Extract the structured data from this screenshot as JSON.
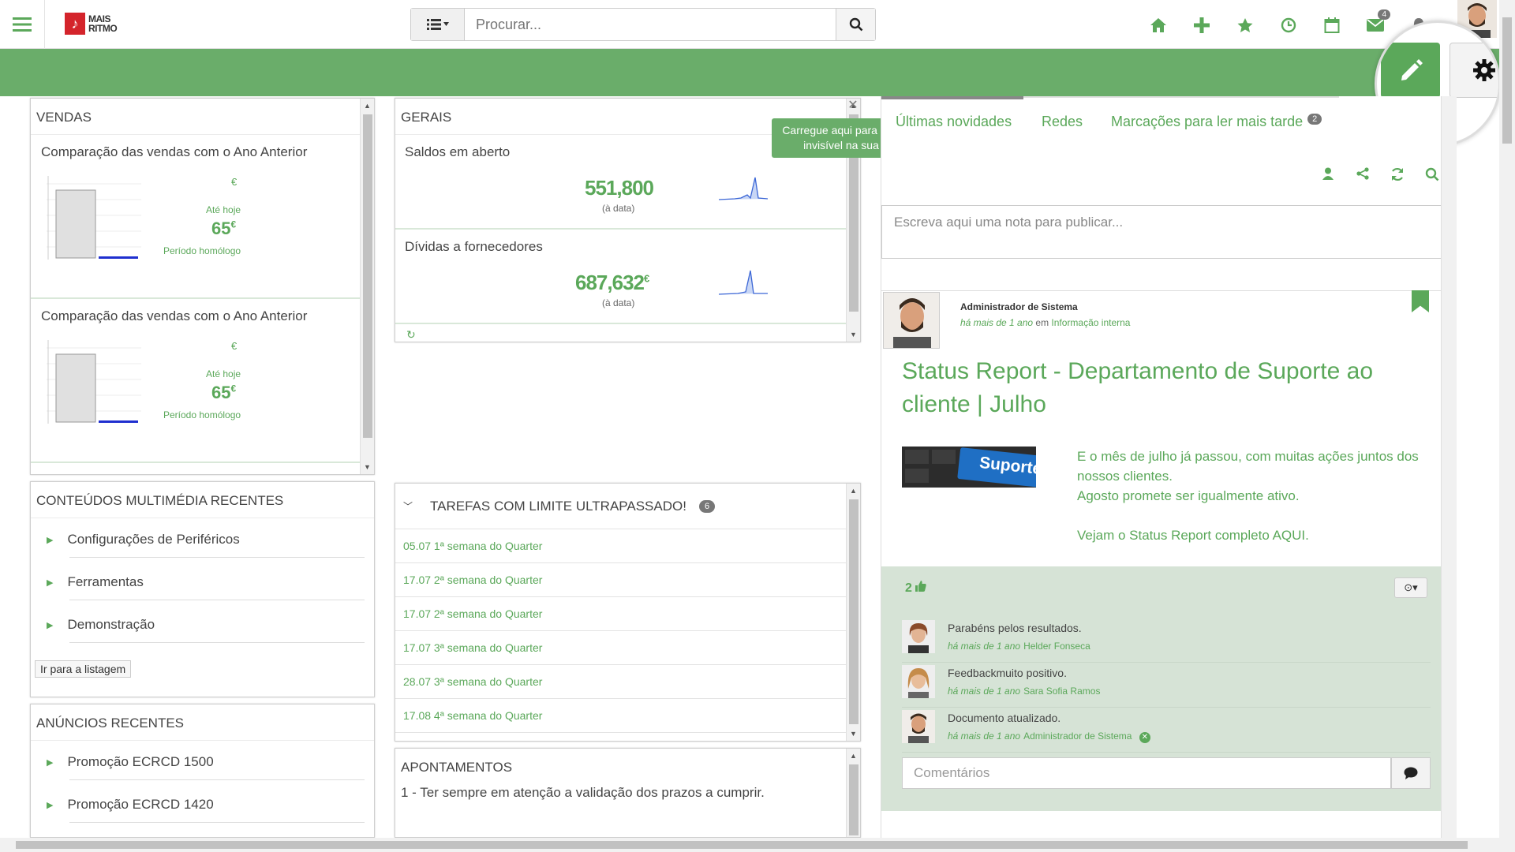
{
  "header": {
    "logo_line1": "MAIS",
    "logo_line2": "RITMO",
    "search_placeholder": "Procurar...",
    "mail_count": "4"
  },
  "tooltip": "Carregue aqui para colocar o objeto invisível na sua homepage.",
  "vendas": {
    "title": "VENDAS",
    "sections": [
      {
        "heading": "Comparação das vendas com o Ano Anterior",
        "currency": "€",
        "ate_hoje": "Até hoje",
        "value": "65",
        "value_currency": "€",
        "periodo": "Período homólogo"
      },
      {
        "heading": "Comparação das vendas com o Ano Anterior",
        "currency": "€",
        "ate_hoje": "Até hoje",
        "value": "65",
        "value_currency": "€",
        "periodo": "Período homólogo"
      }
    ]
  },
  "gerais": {
    "title": "GERAIS",
    "items": [
      {
        "label": "Saldos em aberto",
        "value": "551,800",
        "currency": "",
        "sub": "(à data)"
      },
      {
        "label": "Dívidas a fornecedores",
        "value": "687,632",
        "currency": "€",
        "sub": "(à data)"
      }
    ]
  },
  "multimedia": {
    "title": "CONTEÚDOS MULTIMÉDIA RECENTES",
    "items": [
      "Configurações de Periféricos",
      "Ferramentas",
      "Demonstração"
    ],
    "link": "Ir para a listagem"
  },
  "anuncios": {
    "title": "ANÚNCIOS RECENTES",
    "items": [
      "Promoção ECRCD 1500",
      "Promoção ECRCD 1420"
    ]
  },
  "tarefas": {
    "title": "TAREFAS COM LIMITE ULTRAPASSADO!",
    "count": "6",
    "items": [
      "05.07 1ª semana do Quarter",
      "17.07 2ª semana do Quarter",
      "17.07 2ª semana do Quarter",
      "17.07 3ª semana do Quarter",
      "28.07 3ª semana do Quarter",
      "17.08 4ª semana do Quarter"
    ]
  },
  "apontamentos": {
    "title": "APONTAMENTOS",
    "item": "1 - Ter sempre em atenção a validação dos prazos a cumprir."
  },
  "feed": {
    "tabs": [
      "Últimas novidades",
      "Redes",
      "Marcações para ler mais tarde"
    ],
    "marcacoes_count": "2",
    "note_placeholder": "Escreva aqui uma nota para publicar...",
    "post": {
      "author": "Administrador de Sistema",
      "time": "há mais de 1 ano",
      "in_word": "em",
      "category": "Informação interna",
      "title": "Status Report - Departamento de Suporte ao cliente | Julho",
      "image_label": "Suporte",
      "body": [
        "E o mês de julho já passou, com muitas ações juntos dos nossos clientes.",
        "Agosto promete ser igualmente ativo.",
        "",
        "Vejam o Status Report completo AQUI."
      ],
      "likes": "2",
      "comments": [
        {
          "text": "Parabéns pelos resultados.",
          "time": "há mais de 1 ano",
          "author": "Helder Fonseca"
        },
        {
          "text": "Feedbackmuito positivo.",
          "time": "há mais de 1 ano",
          "author": "Sara Sofia Ramos"
        },
        {
          "text": "Documento atualizado.",
          "time": "há mais de 1 ano",
          "author": "Administrador de Sistema"
        }
      ],
      "comment_placeholder": "Comentários"
    }
  },
  "colors": {
    "accent": "#5ba85a",
    "bar": "#6aad6a"
  }
}
